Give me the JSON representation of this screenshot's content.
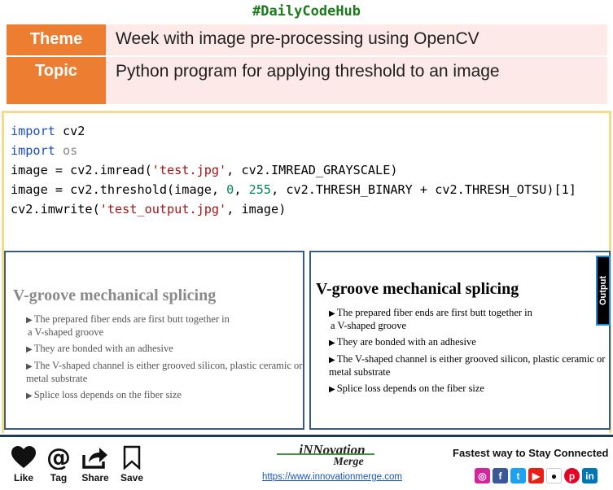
{
  "header": {
    "hashtag": "#DailyCodeHub"
  },
  "info": {
    "theme_label": "Theme",
    "theme_value": "Week with image pre-processing using OpenCV",
    "topic_label": "Topic",
    "topic_value": "Python program for applying threshold to an image"
  },
  "code": {
    "l1": {
      "kw": "import",
      "rest": " cv2"
    },
    "l2": {
      "kw": "import",
      "mod": " os"
    },
    "l3": {
      "a": "image = cv2.imread(",
      "s": "'test.jpg'",
      "b": ", cv2.IMREAD_GRAYSCALE)"
    },
    "l4": {
      "a": "image = cv2.threshold(image, ",
      "n1": "0",
      "c": ", ",
      "n2": "255",
      "d": ", cv2.THRESH_BINARY + cv2.THRESH_OTSU)[1]"
    },
    "l5": {
      "a": "cv2.imwrite(",
      "s": "'test_output.jpg'",
      "b": ", image)"
    }
  },
  "slide": {
    "title": "V-groove mechanical splicing",
    "bullet1": "The prepared fiber ends are first butt together in",
    "bullet1_cont": "a V-shaped groove",
    "bullet2": "They are bonded with an adhesive",
    "bullet3": "The V-shaped channel is either grooved silicon, plastic ceramic or metal substrate",
    "bullet4": "Splice loss depends on the fiber size"
  },
  "output_label": "Output",
  "footer": {
    "like": "Like",
    "tag": "Tag",
    "share": "Share",
    "save": "Save",
    "brand_name": "iNNovation",
    "brand_sub": "Merge",
    "url": "https://www.innovationmerge.com",
    "connect": "Fastest way to Stay Connected"
  },
  "social_icons": [
    "instagram-icon",
    "facebook-icon",
    "twitter-icon",
    "youtube-icon",
    "github-icon",
    "pinterest-icon",
    "linkedin-icon"
  ],
  "colors": {
    "accent": "#ed7d31",
    "hashtag": "#1a7d1a",
    "panel_border": "#3b5b7a",
    "code_border": "#f3dc8a"
  }
}
